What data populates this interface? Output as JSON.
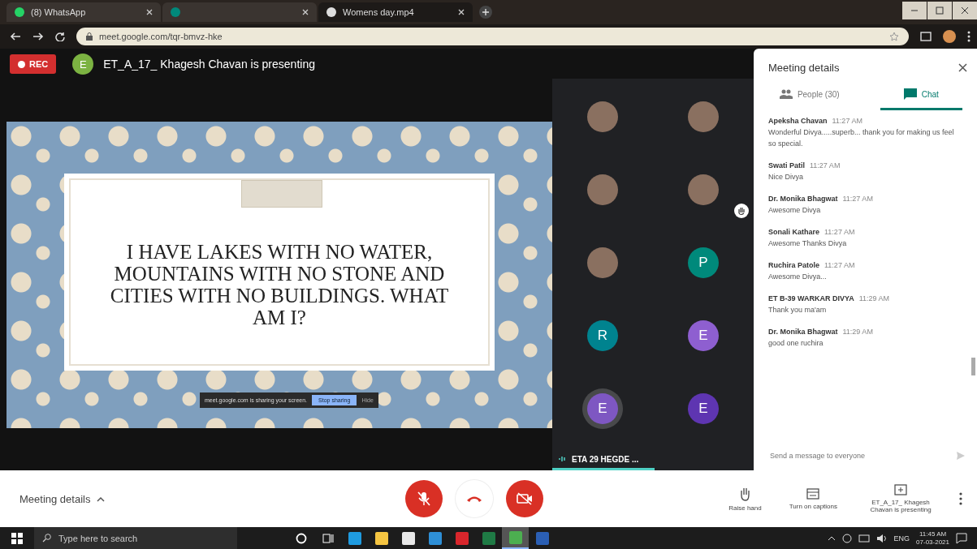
{
  "browser": {
    "tabs": [
      {
        "title": "(8) WhatsApp",
        "selected": false,
        "kind": "whatsapp"
      },
      {
        "selected": false,
        "kind": "meet"
      },
      {
        "title": "Womens day.mp4",
        "selected": true,
        "kind": "globe"
      }
    ],
    "url": "meet.google.com/tqr-bmvz-hke"
  },
  "meeting": {
    "rec": "REC",
    "presenter_avatar": "E",
    "presenter": "ET_A_17_ Khagesh Chavan is presenting",
    "slide": {
      "text": "I HAVE LAKES WITH NO WATER, MOUNTAINS WITH NO STONE AND CITIES WITH NO BUILDINGS. WHAT AM I?"
    },
    "share_bar": {
      "message": "meet.google.com is sharing your screen.",
      "stop": "Stop sharing",
      "hide": "Hide"
    },
    "tiles": [
      {
        "kind": "photo",
        "hand_raised": false,
        "speaking": false
      },
      {
        "kind": "photo",
        "hand_raised": false,
        "speaking": false
      },
      {
        "kind": "photo",
        "hand_raised": false,
        "speaking": false
      },
      {
        "kind": "photo",
        "hand_raised": true,
        "speaking": false
      },
      {
        "kind": "photo",
        "hand_raised": false,
        "speaking": false
      },
      {
        "kind": "letter",
        "letter": "P",
        "color": "#00897b",
        "hand_raised": false,
        "speaking": false
      },
      {
        "kind": "letter",
        "letter": "R",
        "color": "#00838f",
        "hand_raised": false,
        "speaking": false
      },
      {
        "kind": "letter",
        "letter": "E",
        "color": "#8e5fd0",
        "hand_raised": false,
        "speaking": false
      },
      {
        "kind": "letter",
        "letter": "E",
        "color": "#7e57c2",
        "hand_raised": false,
        "speaking": true
      },
      {
        "kind": "letter",
        "letter": "E",
        "color": "#5e35b1",
        "hand_raised": false,
        "speaking": false
      }
    ],
    "speaker": "ETA 29 HEGDE ..."
  },
  "panel": {
    "title": "Meeting details",
    "tabs": [
      {
        "label": "People (30)",
        "kind": "people",
        "selected": false
      },
      {
        "label": "Chat",
        "kind": "chat",
        "selected": true
      }
    ],
    "messages": [
      {
        "sender": "Apeksha Chavan",
        "time": "11:27 AM",
        "text": "Wonderful Divya.....superb... thank you for making us feel so special."
      },
      {
        "sender": "Swati Patil",
        "time": "11:27 AM",
        "text": "Nice Divya"
      },
      {
        "sender": "Dr. Monika Bhagwat",
        "time": "11:27 AM",
        "text": "Awesome Divya"
      },
      {
        "sender": "Sonali Kathare",
        "time": "11:27 AM",
        "text": "Awesome Thanks Divya"
      },
      {
        "sender": "Ruchira Patole",
        "time": "11:27 AM",
        "text": "Awesome Divya..."
      },
      {
        "sender": "ET B-39 WARKAR DIVYA",
        "time": "11:29 AM",
        "text": "Thank you ma'am"
      },
      {
        "sender": "Dr. Monika Bhagwat",
        "time": "11:29 AM",
        "text": "good one ruchira"
      }
    ],
    "input": {
      "placeholder": "Send a message to everyone"
    }
  },
  "controls": {
    "details": "Meeting details",
    "mic_muted": true,
    "camera_off": true,
    "actions": [
      {
        "kind": "hand",
        "label": "Raise hand"
      },
      {
        "kind": "captions",
        "label": "Turn on captions"
      },
      {
        "kind": "present",
        "label": "ET_A_17_ Khagesh Chavan is presenting"
      }
    ]
  },
  "taskbar": {
    "search": {
      "placeholder": "Type here to search"
    },
    "apps": [
      {
        "kind": "cortana",
        "active": false
      },
      {
        "kind": "taskview",
        "active": false
      },
      {
        "kind": "edge",
        "active": false
      },
      {
        "kind": "explorer",
        "active": false
      },
      {
        "kind": "store",
        "active": false
      },
      {
        "kind": "mail",
        "active": false
      },
      {
        "kind": "pdf",
        "active": false
      },
      {
        "kind": "excel",
        "active": false
      },
      {
        "kind": "chrome",
        "active": true
      },
      {
        "kind": "word",
        "active": false
      }
    ],
    "language": "ENG",
    "time": "11:45 AM",
    "date": "07-03-2021"
  }
}
